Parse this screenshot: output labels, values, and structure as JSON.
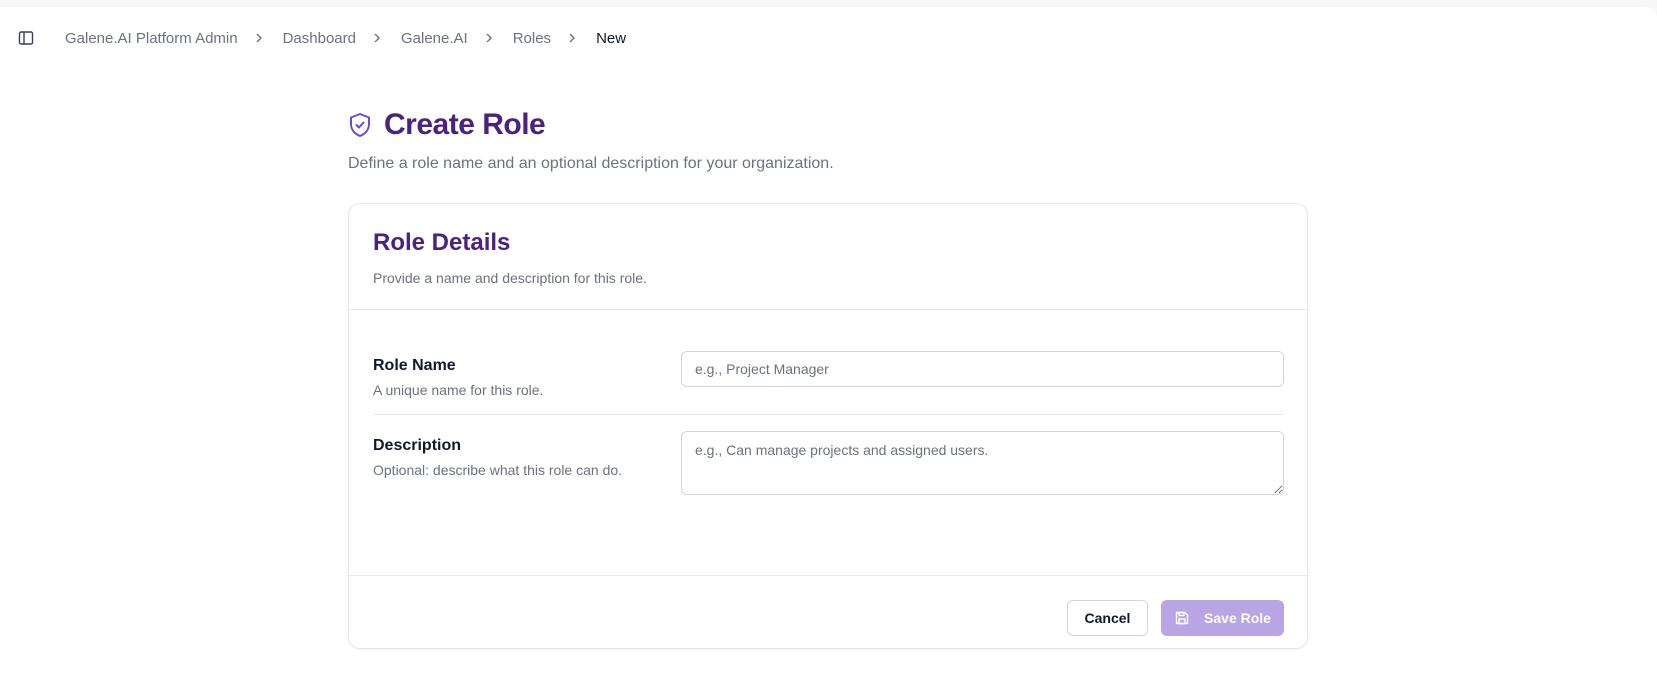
{
  "breadcrumb": {
    "items": [
      "Galene.AI Platform Admin",
      "Dashboard",
      "Galene.AI",
      "Roles",
      "New"
    ]
  },
  "page": {
    "title": "Create Role",
    "subtitle": "Define a role name and an optional description for your organization."
  },
  "card": {
    "title": "Role Details",
    "description": "Provide a name and description for this role.",
    "fields": {
      "role_name": {
        "label": "Role Name",
        "hint": "A unique name for this role.",
        "value": "",
        "placeholder": "e.g., Project Manager"
      },
      "description": {
        "label": "Description",
        "hint": "Optional: describe what this role can do.",
        "value": "",
        "placeholder": "e.g., Can manage projects and assigned users."
      }
    },
    "actions": {
      "cancel_label": "Cancel",
      "save_label": "Save Role"
    }
  },
  "icons": {
    "sidebar_toggle": "sidebar-toggle-icon",
    "breadcrumb_separator": "chevron-right-icon",
    "title": "shield-check-icon",
    "save": "save-icon"
  },
  "colors": {
    "accent": "#4a2280",
    "icon_accent": "#6d4bd0",
    "save_button_disabled": "#b9a5e3",
    "muted_text": "#6b7280"
  }
}
